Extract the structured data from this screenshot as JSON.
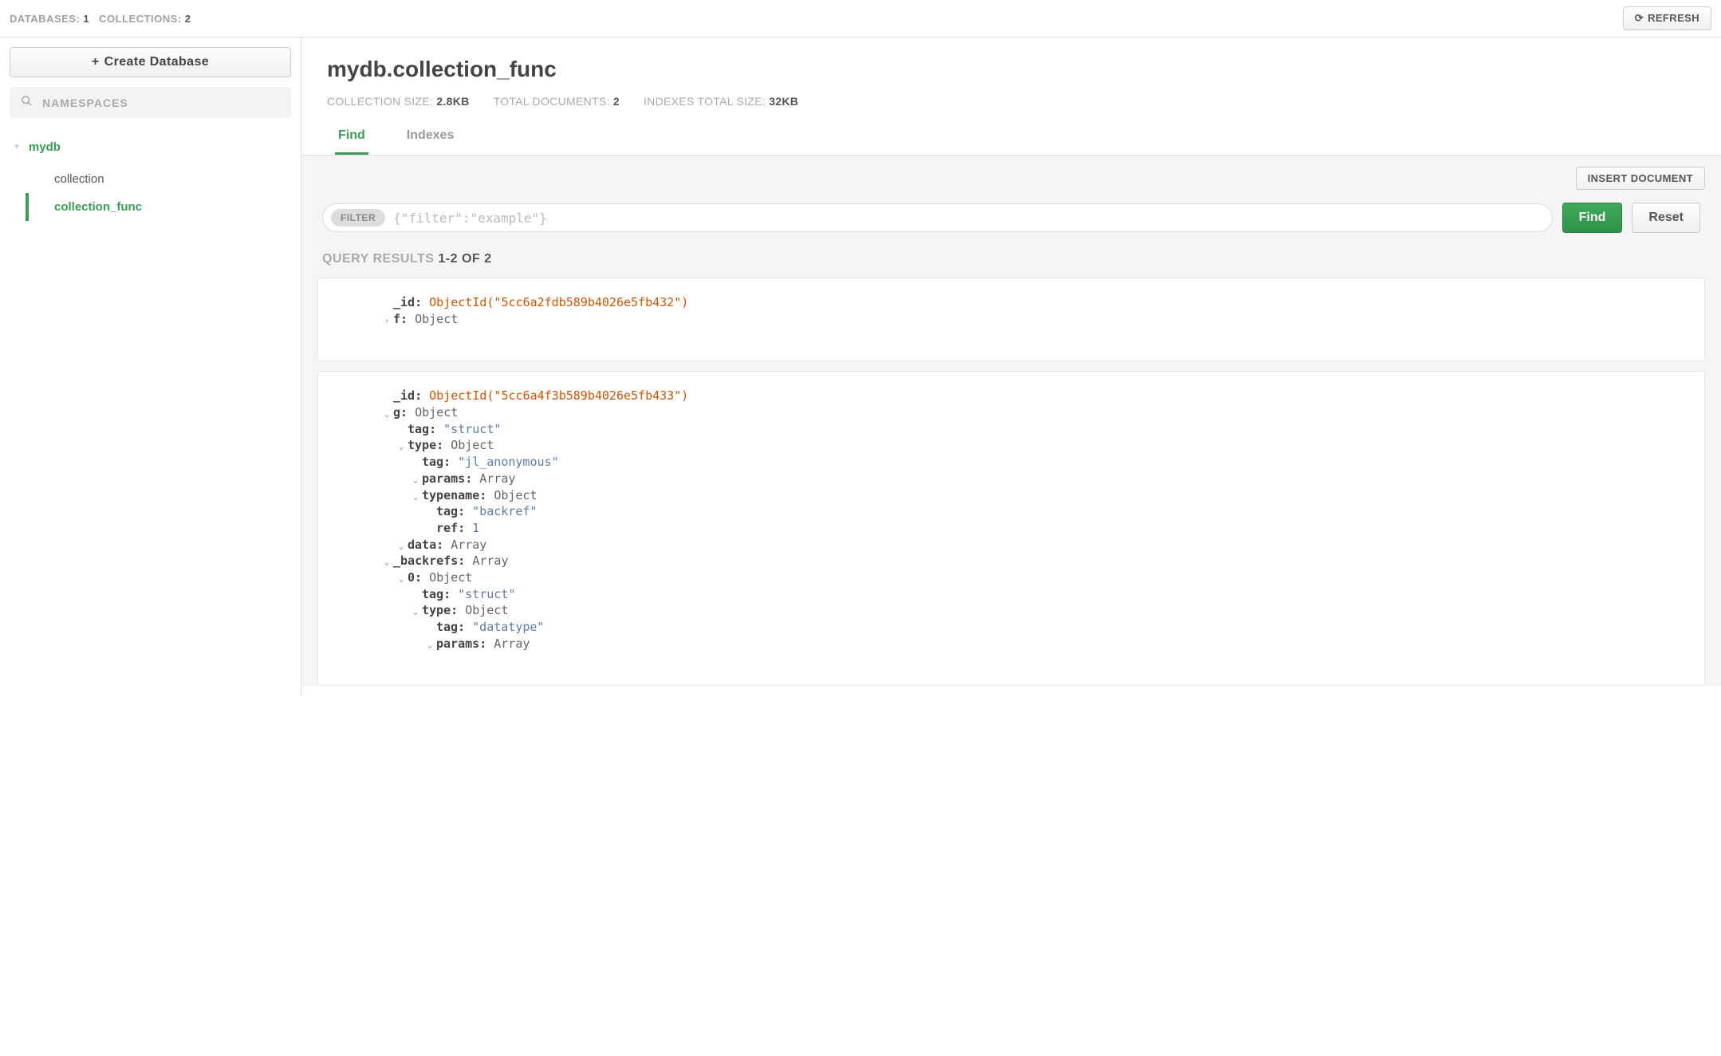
{
  "topbar": {
    "databases_label": "DATABASES:",
    "databases_count": "1",
    "collections_label": "COLLECTIONS:",
    "collections_count": "2",
    "refresh_label": "REFRESH"
  },
  "sidebar": {
    "create_db_label": "Create Database",
    "namespaces_placeholder": "NAMESPACES",
    "db_name": "mydb",
    "collections": [
      {
        "label": "collection",
        "active": false
      },
      {
        "label": "collection_func",
        "active": true
      }
    ]
  },
  "header": {
    "namespace": "mydb.collection_func",
    "stats": {
      "coll_size_label": "COLLECTION SIZE:",
      "coll_size_value": "2.8KB",
      "total_docs_label": "TOTAL DOCUMENTS:",
      "total_docs_value": "2",
      "index_size_label": "INDEXES TOTAL SIZE:",
      "index_size_value": "32KB"
    },
    "tabs": {
      "find": "Find",
      "indexes": "Indexes"
    }
  },
  "panel": {
    "insert_label": "INSERT DOCUMENT",
    "filter_pill": "FILTER",
    "filter_placeholder": "{\"filter\":\"example\"}",
    "find_label": "Find",
    "reset_label": "Reset",
    "query_results_label": "QUERY RESULTS",
    "query_results_range": "1-2 OF 2"
  },
  "docs": [
    {
      "rows": [
        {
          "indent": 1,
          "caret": "",
          "key": "_id",
          "val_type": "oid",
          "val": "ObjectId(\"5cc6a2fdb589b4026e5fb432\")"
        },
        {
          "indent": 1,
          "caret": "right",
          "key": "f",
          "val_type": "ty",
          "val": "Object"
        }
      ]
    },
    {
      "rows": [
        {
          "indent": 1,
          "caret": "",
          "key": "_id",
          "val_type": "oid",
          "val": "ObjectId(\"5cc6a4f3b589b4026e5fb433\")"
        },
        {
          "indent": 1,
          "caret": "down",
          "key": "g",
          "val_type": "ty",
          "val": "Object"
        },
        {
          "indent": 2,
          "caret": "",
          "key": "tag",
          "val_type": "str",
          "val": "\"struct\""
        },
        {
          "indent": 2,
          "caret": "down",
          "key": "type",
          "val_type": "ty",
          "val": "Object"
        },
        {
          "indent": 3,
          "caret": "",
          "key": "tag",
          "val_type": "str",
          "val": "\"jl_anonymous\""
        },
        {
          "indent": 3,
          "caret": "down",
          "key": "params",
          "val_type": "ty",
          "val": "Array"
        },
        {
          "indent": 3,
          "caret": "down",
          "key": "typename",
          "val_type": "ty",
          "val": "Object"
        },
        {
          "indent": 4,
          "caret": "",
          "key": "tag",
          "val_type": "str",
          "val": "\"backref\""
        },
        {
          "indent": 4,
          "caret": "",
          "key": "ref",
          "val_type": "num",
          "val": "1"
        },
        {
          "indent": 2,
          "caret": "down",
          "key": "data",
          "val_type": "ty",
          "val": "Array"
        },
        {
          "indent": 1,
          "caret": "down",
          "key": "_backrefs",
          "val_type": "ty",
          "val": "Array"
        },
        {
          "indent": 2,
          "caret": "down",
          "key": "0",
          "val_type": "ty",
          "val": "Object"
        },
        {
          "indent": 3,
          "caret": "",
          "key": "tag",
          "val_type": "str",
          "val": "\"struct\""
        },
        {
          "indent": 3,
          "caret": "down",
          "key": "type",
          "val_type": "ty",
          "val": "Object"
        },
        {
          "indent": 4,
          "caret": "",
          "key": "tag",
          "val_type": "str",
          "val": "\"datatype\""
        },
        {
          "indent": 4,
          "caret": "down",
          "key": "params",
          "val_type": "ty",
          "val": "Array"
        }
      ]
    }
  ]
}
